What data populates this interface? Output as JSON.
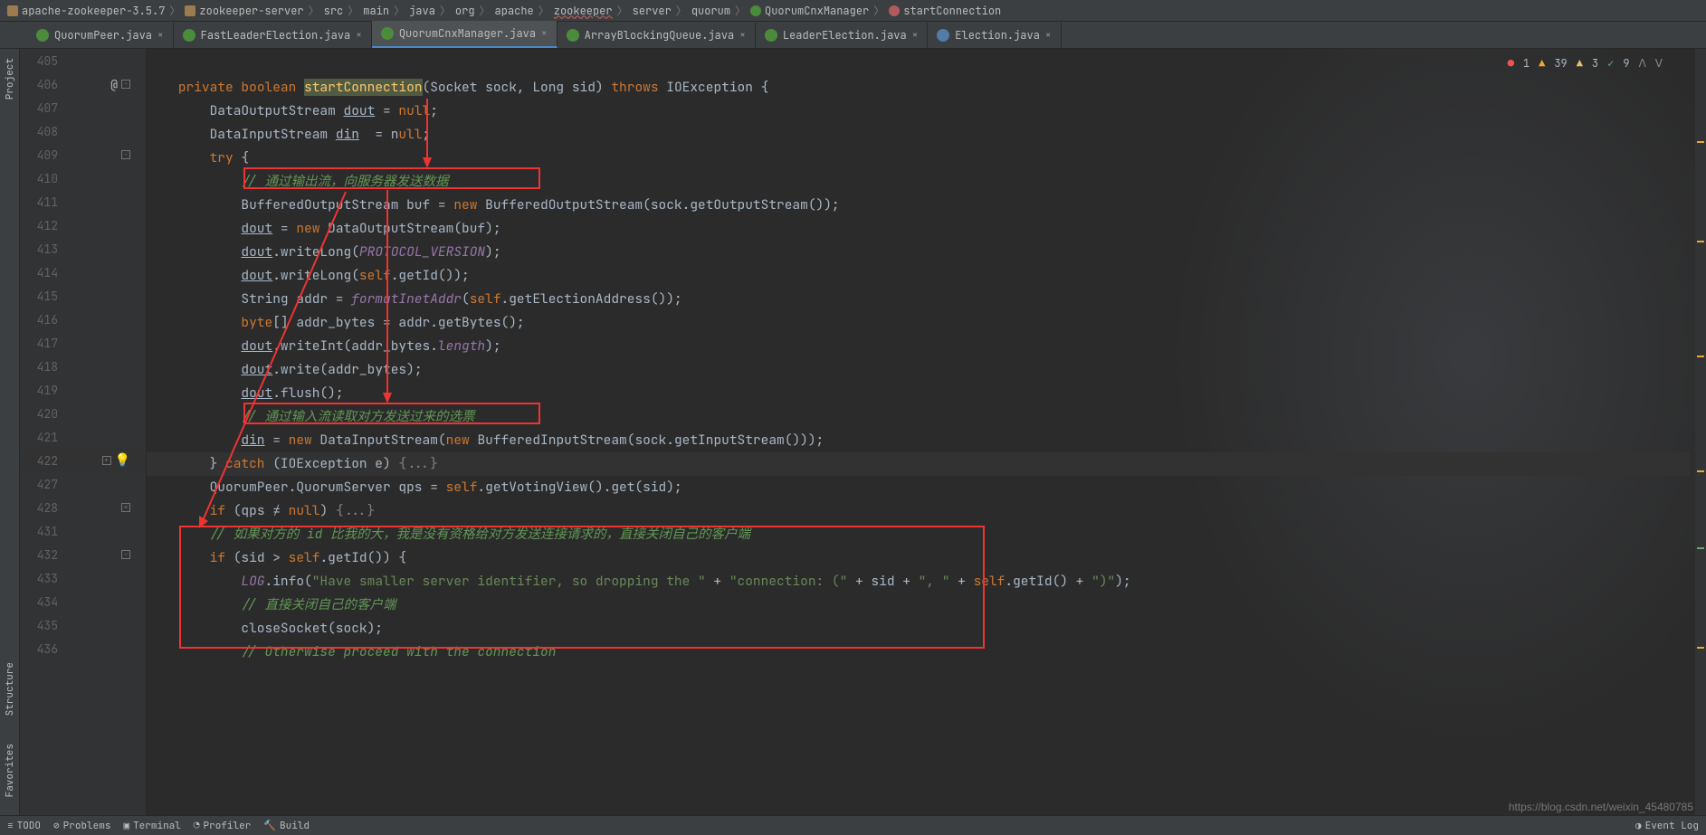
{
  "breadcrumb": [
    {
      "icon": "folder",
      "label": "apache-zookeeper-3.5.7"
    },
    {
      "icon": "folder",
      "label": "zookeeper-server"
    },
    {
      "icon": "",
      "label": "src"
    },
    {
      "icon": "",
      "label": "main"
    },
    {
      "icon": "",
      "label": "java"
    },
    {
      "icon": "",
      "label": "org"
    },
    {
      "icon": "",
      "label": "apache"
    },
    {
      "icon": "",
      "label": "zookeeper",
      "wavy": true
    },
    {
      "icon": "",
      "label": "server"
    },
    {
      "icon": "",
      "label": "quorum"
    },
    {
      "icon": "class",
      "label": "QuorumCnxManager"
    },
    {
      "icon": "method",
      "label": "startConnection"
    }
  ],
  "tabs": [
    {
      "icon": "java",
      "label": "QuorumPeer.java",
      "active": false
    },
    {
      "icon": "java",
      "label": "FastLeaderElection.java",
      "active": false
    },
    {
      "icon": "java",
      "label": "QuorumCnxManager.java",
      "active": true
    },
    {
      "icon": "java",
      "label": "ArrayBlockingQueue.java",
      "active": false
    },
    {
      "icon": "java",
      "label": "LeaderElection.java",
      "active": false
    },
    {
      "icon": "java2",
      "label": "Election.java",
      "active": false
    }
  ],
  "left_tools": [
    {
      "label": "Project"
    },
    {
      "label": "Structure"
    },
    {
      "label": "Favorites"
    }
  ],
  "inspections": {
    "err": "1",
    "warn": "39",
    "weak": "3",
    "typo": "9"
  },
  "lines": [
    {
      "n": "405"
    },
    {
      "n": "406",
      "marks": [
        "@",
        "-"
      ]
    },
    {
      "n": "407"
    },
    {
      "n": "408"
    },
    {
      "n": "409",
      "marks": [
        "-"
      ]
    },
    {
      "n": "410"
    },
    {
      "n": "411"
    },
    {
      "n": "412"
    },
    {
      "n": "413"
    },
    {
      "n": "414"
    },
    {
      "n": "415"
    },
    {
      "n": "416"
    },
    {
      "n": "417"
    },
    {
      "n": "418"
    },
    {
      "n": "419"
    },
    {
      "n": "420"
    },
    {
      "n": "421"
    },
    {
      "n": "422",
      "marks": [
        "+",
        "bulb"
      ],
      "cur": true
    },
    {
      "n": "427"
    },
    {
      "n": "428",
      "marks": [
        "+"
      ]
    },
    {
      "n": "431"
    },
    {
      "n": "432",
      "marks": [
        "-"
      ]
    },
    {
      "n": "433"
    },
    {
      "n": "434"
    },
    {
      "n": "435"
    },
    {
      "n": "436"
    }
  ],
  "code": {
    "l406_kw1": "private",
    "l406_kw2": "boolean",
    "l406_m": "startConnection",
    "l406_p": "(Socket sock, Long sid) ",
    "l406_kw3": "throws",
    "l406_t": " IOException {",
    "l407": "        DataOutputStream ",
    "l407_u": "dout",
    "l407_eq": " = ",
    "l407_kw": "null",
    "l407_se": ";",
    "l408": "        DataInputStream ",
    "l408_u": "din",
    "l408_eq": "  = n",
    "l408_kw": "ull",
    "l408_se": ";",
    "l409_kw": "        try ",
    "l409_b": "{",
    "l410_c": "            // 通过输出流，向服务器发送数据",
    "l411a": "            BufferedOutputStream buf = ",
    "l411_kw": "new",
    "l411b": " BufferedOutputStream(sock.getOutputStream());",
    "l412a": "            ",
    "l412_u": "dout",
    "l412b": " = ",
    "l412_kw": "new",
    "l412c": " DataOutputStream(buf);",
    "l413a": "            ",
    "l413_u": "dout",
    "l413b": ".writeLong(",
    "l413_f": "PROTOCOL_VERSION",
    "l413c": ");",
    "l414a": "            ",
    "l414_u": "dout",
    "l414b": ".writeLong(",
    "l414_kw": "self",
    "l414c": ".getId());",
    "l415a": "            String addr = ",
    "l415_m": "formatInetAddr",
    "l415b": "(",
    "l415_kw": "self",
    "l415c": ".getElectionAddress());",
    "l416a": "            ",
    "l416_kw": "byte",
    "l416b": "[] addr_bytes = addr.getBytes();",
    "l417a": "            ",
    "l417_u": "dout",
    "l417b": ".writeInt(addr_bytes.",
    "l417_f": "length",
    "l417c": ");",
    "l418a": "            ",
    "l418_u": "dout",
    "l418b": ".write(addr_bytes);",
    "l419a": "            ",
    "l419_u": "dout",
    "l419b": ".flush();",
    "l420_c": "            // 通过输入流读取对方发送过来的选票",
    "l421a": "            ",
    "l421_u": "din",
    "l421b": " = ",
    "l421_kw": "new",
    "l421c": " DataInputStream(",
    "l421_kw2": "new",
    "l421d": " BufferedInputStream(sock.getInputStream()));",
    "l422a": "        } ",
    "l422_kw": "catch",
    "l422b": " (IOException e) ",
    "l422_fold": "{...}",
    "l427a": "        QuorumPeer.QuorumServer qps = ",
    "l427_kw": "self",
    "l427b": ".getVotingView().get(sid);",
    "l428a": "        ",
    "l428_kw": "if",
    "l428b": " (qps ≠ ",
    "l428_kw2": "null",
    "l428c": ") ",
    "l428_fold": "{...}",
    "l431_c": "        // 如果对方的 id 比我的大，我是没有资格给对方发送连接请求的，直接关闭自己的客户端",
    "l432a": "        ",
    "l432_kw": "if",
    "l432b": " (sid > ",
    "l432_kw2": "self",
    "l432c": ".getId()) {",
    "l433a": "            ",
    "l433_f": "LOG",
    "l433b": ".info(",
    "l433_s": "\"Have smaller server identifier, so dropping the \"",
    "l433c": " + ",
    "l433_s2": "\"connection: (\"",
    "l433d": " + sid + ",
    "l433_s3": "\", \"",
    "l433e": " + ",
    "l433_kw": "self",
    "l433f": ".getId() + ",
    "l433_s4": "\")\"",
    "l433g": ");",
    "l434_c": "            // 直接关闭自己的客户端",
    "l435a": "            closeSocket(sock);",
    "l436_c": "            // Otherwise proceed with the connection"
  },
  "bottom": {
    "todo": "TODO",
    "problems": "Problems",
    "terminal": "Terminal",
    "profiler": "Profiler",
    "build": "Build",
    "eventlog": "Event Log"
  },
  "watermark": "https://blog.csdn.net/weixin_45480785"
}
